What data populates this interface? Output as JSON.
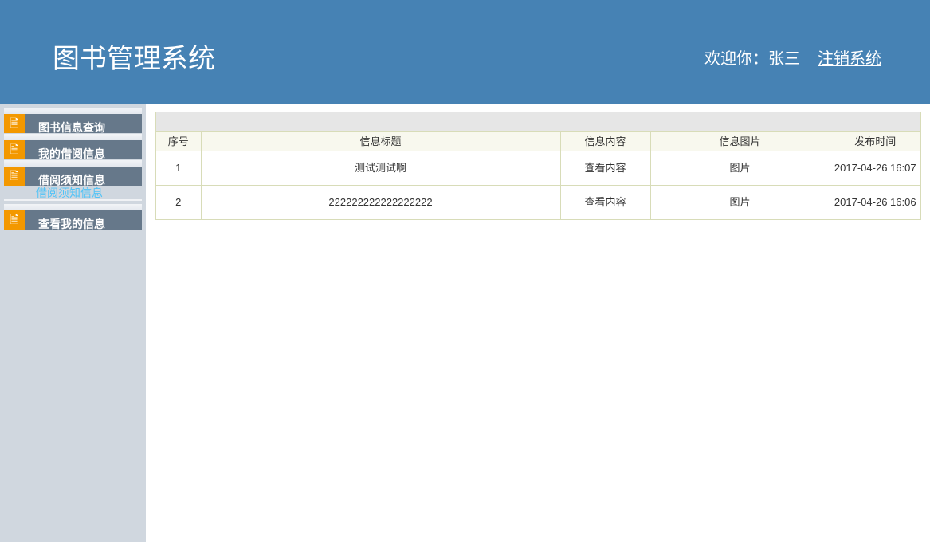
{
  "header": {
    "title": "图书管理系统",
    "welcome": "欢迎你：张三",
    "logout": "注销系统"
  },
  "sidebar": {
    "items": [
      {
        "label": "图书信息查询"
      },
      {
        "label": "我的借阅信息"
      },
      {
        "label": "借阅须知信息",
        "sub": "借阅须知信息"
      },
      {
        "label": "查看我的信息"
      }
    ]
  },
  "table": {
    "headers": [
      "序号",
      "信息标题",
      "信息内容",
      "信息图片",
      "发布时间"
    ],
    "rows": [
      [
        "1",
        "测试测试啊",
        "查看内容",
        "图片",
        "2017-04-26 16:07"
      ],
      [
        "2",
        "222222222222222222",
        "查看内容",
        "图片",
        "2017-04-26 16:06"
      ]
    ]
  }
}
